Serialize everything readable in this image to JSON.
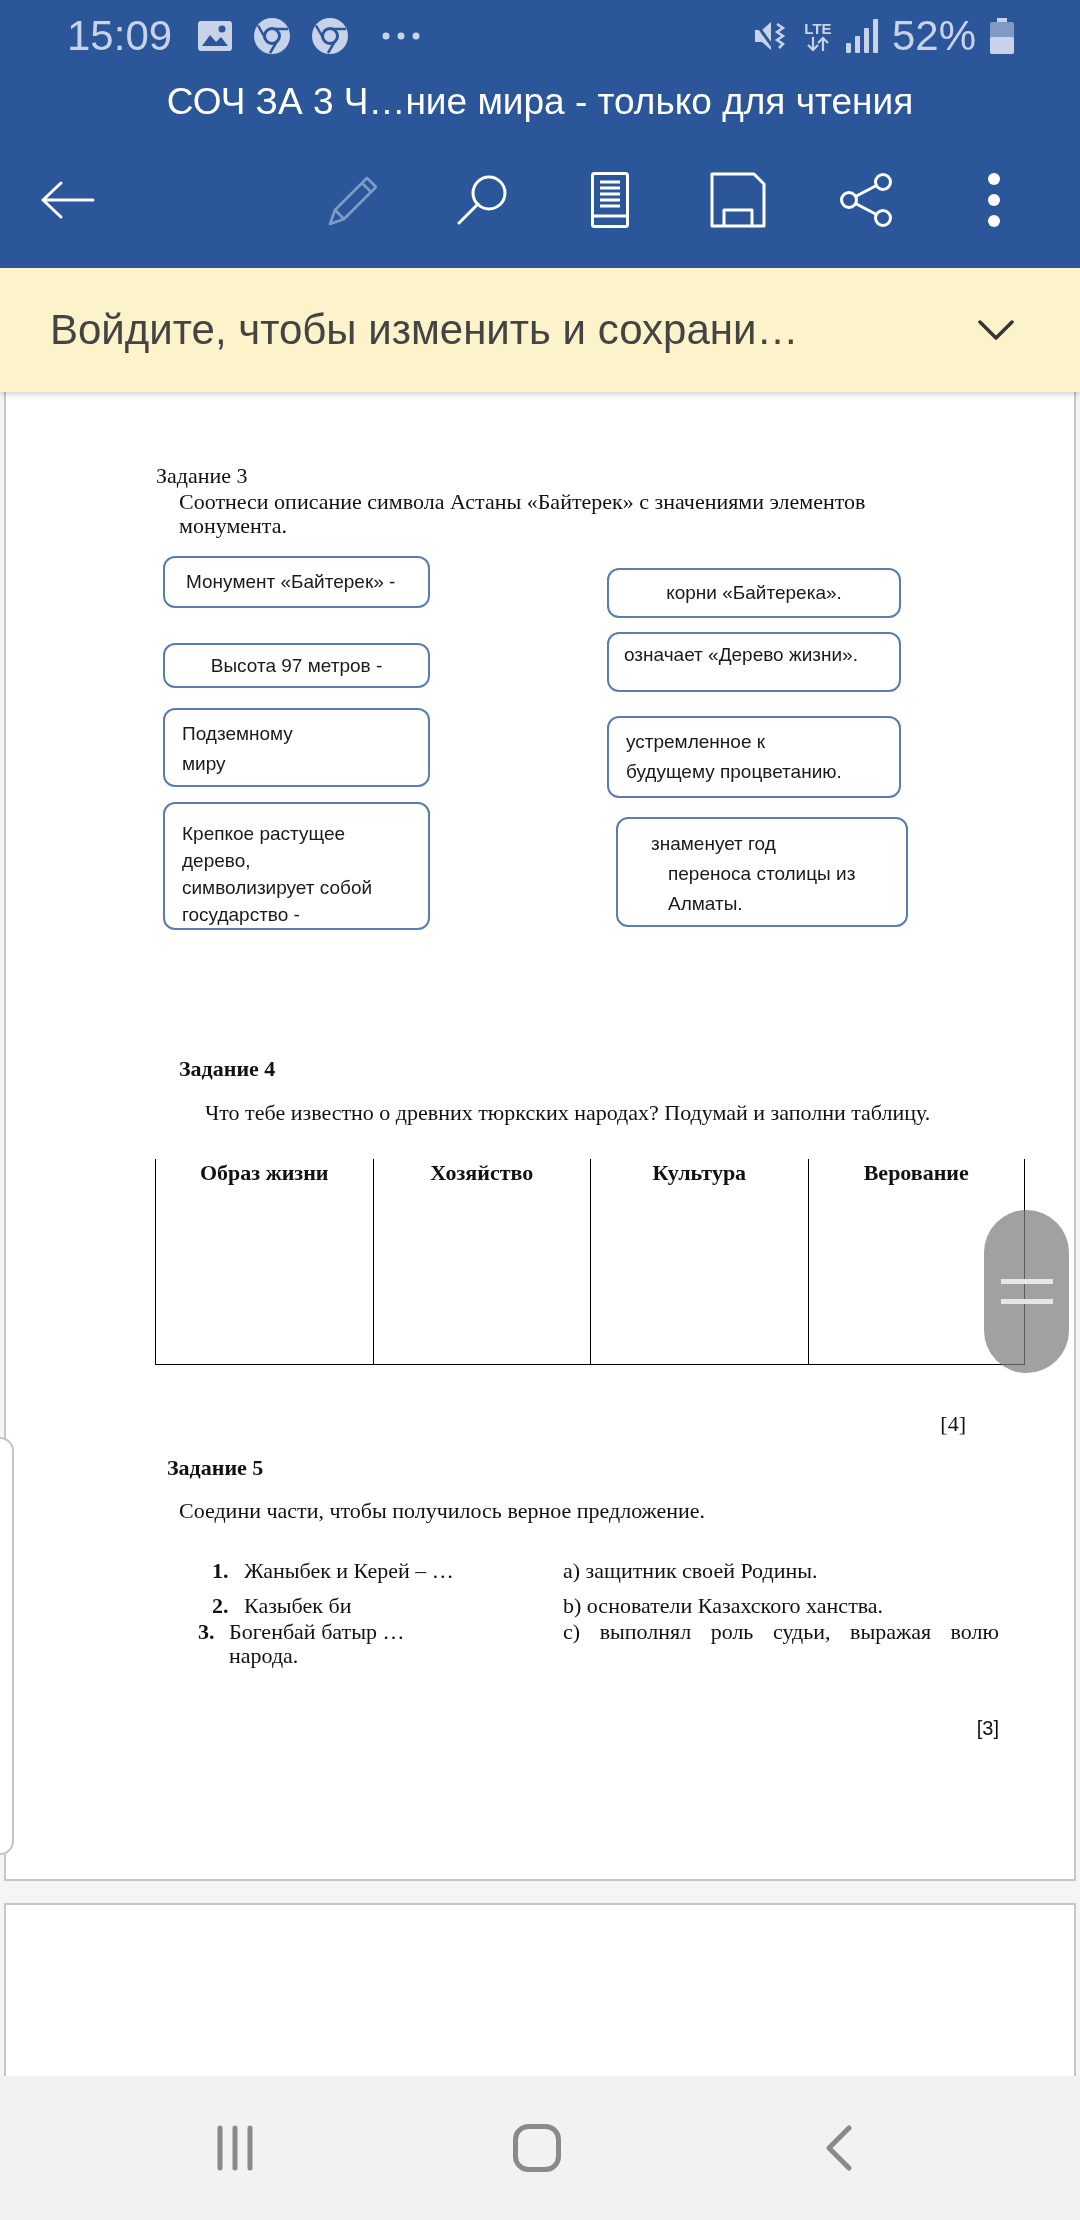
{
  "status_bar": {
    "time": "15:09",
    "network": "LTE",
    "battery": "52%"
  },
  "header": {
    "title": "СОЧ ЗА 3 Ч…ние мира - только для чтения",
    "toolbar": [
      {
        "kind": "back",
        "disabled": false
      },
      {
        "kind": "edit",
        "disabled": true
      },
      {
        "kind": "search",
        "disabled": false
      },
      {
        "kind": "reading",
        "disabled": false
      },
      {
        "kind": "save",
        "disabled": false
      },
      {
        "kind": "share",
        "disabled": false
      },
      {
        "kind": "more",
        "disabled": false
      }
    ]
  },
  "banner": {
    "message": "Войдите, чтобы изменить и сохрани…",
    "expanded": false
  },
  "document": {
    "task_3": {
      "heading": "Задание 3",
      "instruction": "Соотнеси описание символа Астаны «Байтерек» с значениями элементов монумента.",
      "left_cards": [
        {
          "lines": [
            "Монумент «Байтерек» -"
          ]
        },
        {
          "lines": [
            "Высота 97 метров -"
          ]
        },
        {
          "lines": [
            "Подземному",
            "миру"
          ]
        },
        {
          "lines": [
            "Крепкое растущее",
            "дерево,",
            "символизирует собой",
            "государство -"
          ]
        }
      ],
      "right_cards": [
        {
          "lines": [
            "корни «Байтерека»."
          ]
        },
        {
          "lines": [
            "означает «Дерево жизни»."
          ]
        },
        {
          "lines": [
            "устремленное к",
            "будущему процветанию."
          ]
        },
        {
          "lines": [
            "знаменует год",
            "переноса столицы из",
            "Алматы."
          ]
        }
      ]
    },
    "task_4": {
      "heading": "Задание 4",
      "instruction": "Что тебе известно о древних тюркских народах? Подумай и заполни таблицу.",
      "table": {
        "columns": [
          "Образ жизни",
          "Хозяйство",
          "Культура",
          "Верование"
        ]
      },
      "score": "[4]"
    },
    "task_5": {
      "heading": "Задание 5",
      "instruction": "Соедини части, чтобы получилось верное предложение.",
      "rows": [
        {
          "kind": "item",
          "number": "1.",
          "item": "Жаныбек и Керей – …",
          "option": "a) защитник своей Родины."
        },
        {
          "kind": "item",
          "number": "2.",
          "item": "Казыбек би",
          "option": "b) основатели Казахского ханства."
        },
        {
          "kind": "shifted",
          "number": "3.",
          "item": "Богенбай батыр …",
          "option": "c) выполнял роль судьи, выражая волю"
        }
      ],
      "continuation": "народа.",
      "score": "[3]"
    }
  }
}
